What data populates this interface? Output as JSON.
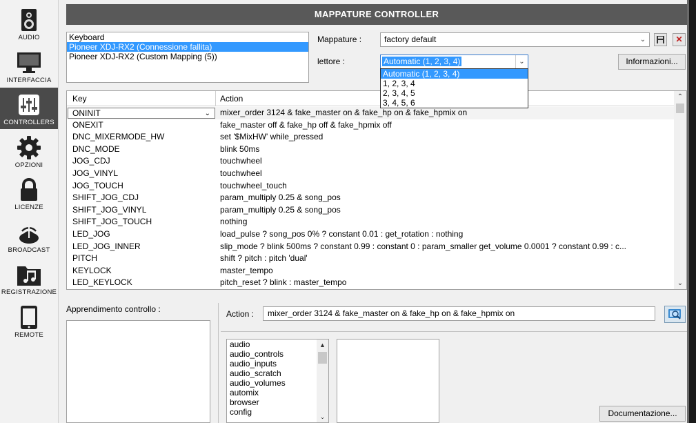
{
  "sidebar": {
    "items": [
      {
        "label": "AUDIO",
        "icon": "speaker-icon"
      },
      {
        "label": "INTERFACCIA",
        "icon": "monitor-icon"
      },
      {
        "label": "CONTROLLERS",
        "icon": "sliders-icon",
        "active": true
      },
      {
        "label": "OPZIONI",
        "icon": "gear-icon"
      },
      {
        "label": "LICENZE",
        "icon": "lock-icon"
      },
      {
        "label": "BROADCAST",
        "icon": "broadcast-icon"
      },
      {
        "label": "REGISTRAZIONE",
        "icon": "music-folder-icon"
      },
      {
        "label": "REMOTE",
        "icon": "tablet-icon"
      }
    ]
  },
  "header": {
    "title": "MAPPATURE CONTROLLER"
  },
  "controllers": {
    "items": [
      "Keyboard",
      "Pioneer XDJ-RX2 (Connessione fallita)",
      "Pioneer XDJ-RX2 (Custom Mapping (5))"
    ],
    "selected_index": 1
  },
  "mappature": {
    "label": "Mappature :",
    "value": "factory default"
  },
  "lettore": {
    "label": "lettore :",
    "value": "Automatic (1, 2, 3, 4)",
    "options": [
      "Automatic (1, 2, 3, 4)",
      "1, 2, 3, 4",
      "2, 3, 4, 5",
      "3, 4, 5, 6"
    ]
  },
  "info_button": "Informazioni...",
  "table": {
    "col_key": "Key",
    "col_action": "Action",
    "rows": [
      {
        "key": "ONINIT",
        "action": "mixer_order 3124 & fake_master on & fake_hp on & fake_hpmix on"
      },
      {
        "key": "ONEXIT",
        "action": "fake_master off & fake_hp off & fake_hpmix off"
      },
      {
        "key": "DNC_MIXERMODE_HW",
        "action": "set '$MixHW' while_pressed"
      },
      {
        "key": "DNC_MODE",
        "action": "blink 50ms"
      },
      {
        "key": "JOG_CDJ",
        "action": "touchwheel"
      },
      {
        "key": "JOG_VINYL",
        "action": "touchwheel"
      },
      {
        "key": "JOG_TOUCH",
        "action": "touchwheel_touch"
      },
      {
        "key": "SHIFT_JOG_CDJ",
        "action": "param_multiply 0.25 & song_pos"
      },
      {
        "key": "SHIFT_JOG_VINYL",
        "action": "param_multiply 0.25 & song_pos"
      },
      {
        "key": "SHIFT_JOG_TOUCH",
        "action": "nothing"
      },
      {
        "key": "LED_JOG",
        "action": "load_pulse ? song_pos 0% ? constant 0.01 : get_rotation : nothing"
      },
      {
        "key": "LED_JOG_INNER",
        "action": "slip_mode ? blink 500ms ? constant 0.99 : constant 0 : param_smaller get_volume 0.0001 ? constant 0.99 : c..."
      },
      {
        "key": "PITCH",
        "action": "shift ? pitch : pitch 'dual'"
      },
      {
        "key": "KEYLOCK",
        "action": "master_tempo"
      },
      {
        "key": "LED_KEYLOCK",
        "action": "pitch_reset ? blink : master_tempo"
      }
    ]
  },
  "learn": {
    "label": "Apprendimento controllo :"
  },
  "action": {
    "label": "Action :",
    "value": "mixer_order 3124 & fake_master on & fake_hp on & fake_hpmix on"
  },
  "categories": [
    "audio",
    "audio_controls",
    "audio_inputs",
    "audio_scratch",
    "audio_volumes",
    "automix",
    "browser",
    "config"
  ],
  "doc_button": "Documentazione..."
}
